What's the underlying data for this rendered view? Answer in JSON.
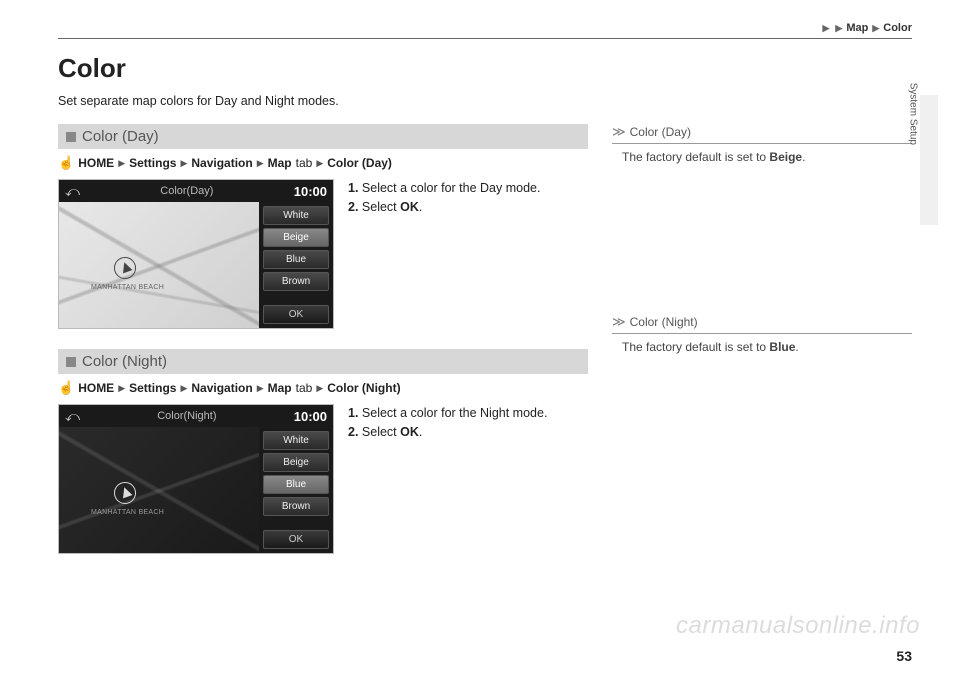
{
  "breadcrumb_top": {
    "a": "Map",
    "b": "Color"
  },
  "side_tab": "System Setup",
  "title": "Color",
  "intro": "Set separate map colors for Day and Night modes.",
  "day": {
    "bar": "Color (Day)",
    "path": {
      "p1": "HOME",
      "p2": "Settings",
      "p3": "Navigation",
      "p4": "Map",
      "tab": "tab",
      "p5": "Color (Day)"
    },
    "screen_title": "Color(Day)",
    "clock": "10:00",
    "map_label": "MANHATTAN BEACH",
    "opts": [
      "White",
      "Beige",
      "Blue",
      "Brown"
    ],
    "selected": "Beige",
    "ok": "OK",
    "step1_n": "1.",
    "step1": " Select a color for the Day mode.",
    "step2_n": "2.",
    "step2_a": " Select ",
    "step2_b": "OK",
    "step2_c": "."
  },
  "night": {
    "bar": "Color (Night)",
    "path": {
      "p1": "HOME",
      "p2": "Settings",
      "p3": "Navigation",
      "p4": "Map",
      "tab": "tab",
      "p5": "Color (Night)"
    },
    "screen_title": "Color(Night)",
    "clock": "10:00",
    "map_label": "MANHATTAN BEACH",
    "opts": [
      "White",
      "Beige",
      "Blue",
      "Brown"
    ],
    "selected": "Blue",
    "ok": "OK",
    "step1_n": "1.",
    "step1": " Select a color for the Night mode.",
    "step2_n": "2.",
    "step2_a": " Select ",
    "step2_b": "OK",
    "step2_c": "."
  },
  "aside_day": {
    "head": "Color (Day)",
    "body_a": "The factory default is set to ",
    "body_b": "Beige",
    "body_c": "."
  },
  "aside_night": {
    "head": "Color (Night)",
    "body_a": "The factory default is set to ",
    "body_b": "Blue",
    "body_c": "."
  },
  "page_number": "53",
  "watermark": "carmanualsonline.info"
}
